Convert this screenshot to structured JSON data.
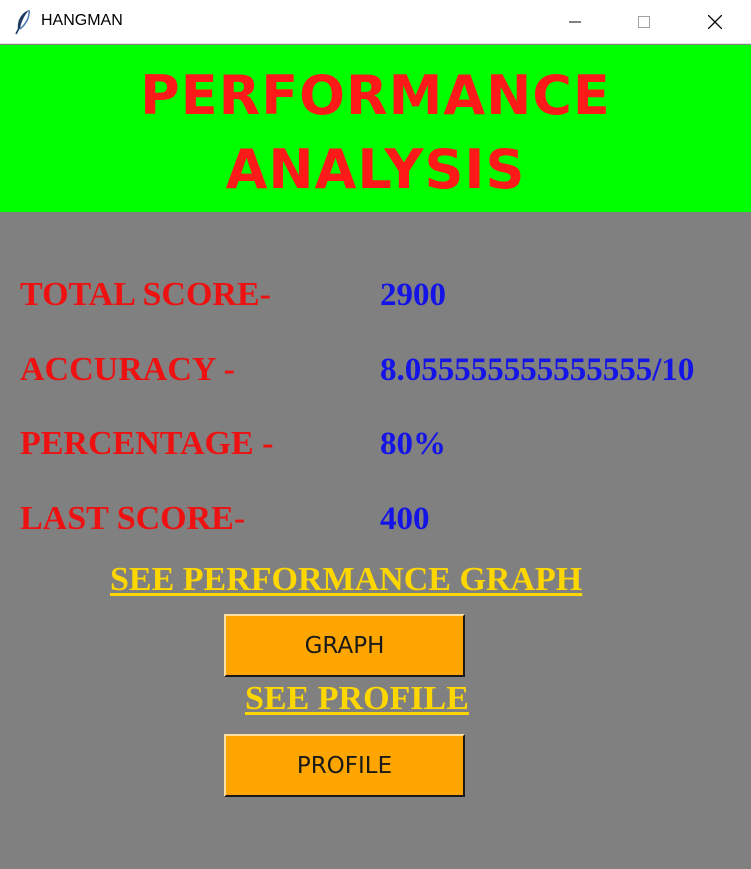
{
  "window": {
    "title": "HANGMAN",
    "icon": "feather-icon"
  },
  "header": {
    "title": "PERFORMANCE\nANALYSIS",
    "background": "#00ff00",
    "text_color": "#ff1a1a"
  },
  "stats": [
    {
      "label": "TOTAL SCORE-",
      "value": "2900"
    },
    {
      "label": "ACCURACY -",
      "value": "8.055555555555555/10"
    },
    {
      "label": "PERCENTAGE -",
      "value": "80%"
    },
    {
      "label": "LAST SCORE-",
      "value": "400"
    }
  ],
  "links": {
    "graph_text": "SEE PERFORMANCE GRAPH",
    "profile_text": "SEE PROFILE"
  },
  "buttons": {
    "graph_label": "GRAPH",
    "profile_label": "PROFILE"
  },
  "colors": {
    "body_background": "#808080",
    "label": "#ee1111",
    "value": "#1414e6",
    "link": "#ffd700",
    "button": "#ffa500"
  }
}
